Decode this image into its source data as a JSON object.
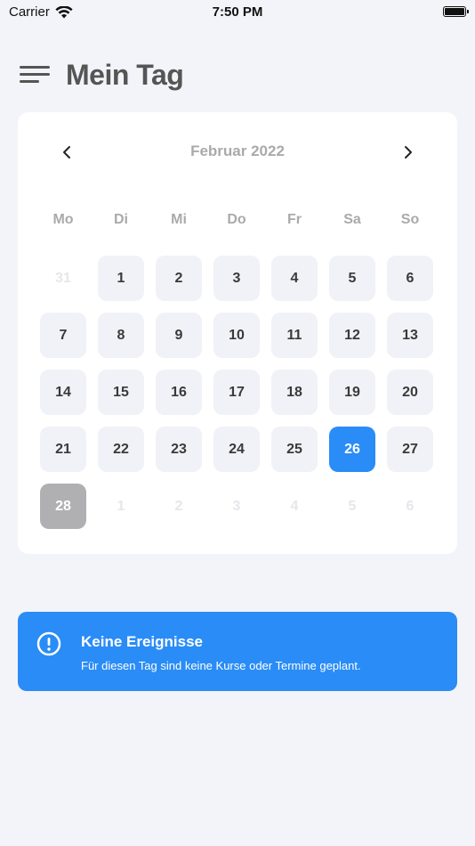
{
  "status_bar": {
    "carrier": "Carrier",
    "time": "7:50 PM",
    "battery_level": 1.0
  },
  "header": {
    "title": "Mein Tag",
    "menu_icon": "hamburger-menu-icon"
  },
  "calendar": {
    "month_label": "Februar 2022",
    "prev_icon": "chevron-left-icon",
    "next_icon": "chevron-right-icon",
    "weekdays": [
      "Mo",
      "Di",
      "Mi",
      "Do",
      "Fr",
      "Sa",
      "So"
    ],
    "days": [
      {
        "label": "31",
        "state": "outside"
      },
      {
        "label": "1",
        "state": "normal"
      },
      {
        "label": "2",
        "state": "normal"
      },
      {
        "label": "3",
        "state": "normal"
      },
      {
        "label": "4",
        "state": "normal"
      },
      {
        "label": "5",
        "state": "normal"
      },
      {
        "label": "6",
        "state": "normal"
      },
      {
        "label": "7",
        "state": "normal"
      },
      {
        "label": "8",
        "state": "normal"
      },
      {
        "label": "9",
        "state": "normal"
      },
      {
        "label": "10",
        "state": "normal"
      },
      {
        "label": "11",
        "state": "normal"
      },
      {
        "label": "12",
        "state": "normal"
      },
      {
        "label": "13",
        "state": "normal"
      },
      {
        "label": "14",
        "state": "normal"
      },
      {
        "label": "15",
        "state": "normal"
      },
      {
        "label": "16",
        "state": "normal"
      },
      {
        "label": "17",
        "state": "normal"
      },
      {
        "label": "18",
        "state": "normal"
      },
      {
        "label": "19",
        "state": "normal"
      },
      {
        "label": "20",
        "state": "normal"
      },
      {
        "label": "21",
        "state": "normal"
      },
      {
        "label": "22",
        "state": "normal"
      },
      {
        "label": "23",
        "state": "normal"
      },
      {
        "label": "24",
        "state": "normal"
      },
      {
        "label": "25",
        "state": "normal"
      },
      {
        "label": "26",
        "state": "selected"
      },
      {
        "label": "27",
        "state": "normal"
      },
      {
        "label": "28",
        "state": "today"
      },
      {
        "label": "1",
        "state": "outside"
      },
      {
        "label": "2",
        "state": "outside"
      },
      {
        "label": "3",
        "state": "outside"
      },
      {
        "label": "4",
        "state": "outside"
      },
      {
        "label": "5",
        "state": "outside"
      },
      {
        "label": "6",
        "state": "outside"
      }
    ]
  },
  "info_banner": {
    "icon": "exclamation-circle-icon",
    "title": "Keine Ereignisse",
    "text": "Für diesen Tag sind keine Kurse oder Termine geplant."
  },
  "colors": {
    "accent": "#2a8cf6",
    "today": "#b0b0b3",
    "background": "#f3f4f9"
  }
}
